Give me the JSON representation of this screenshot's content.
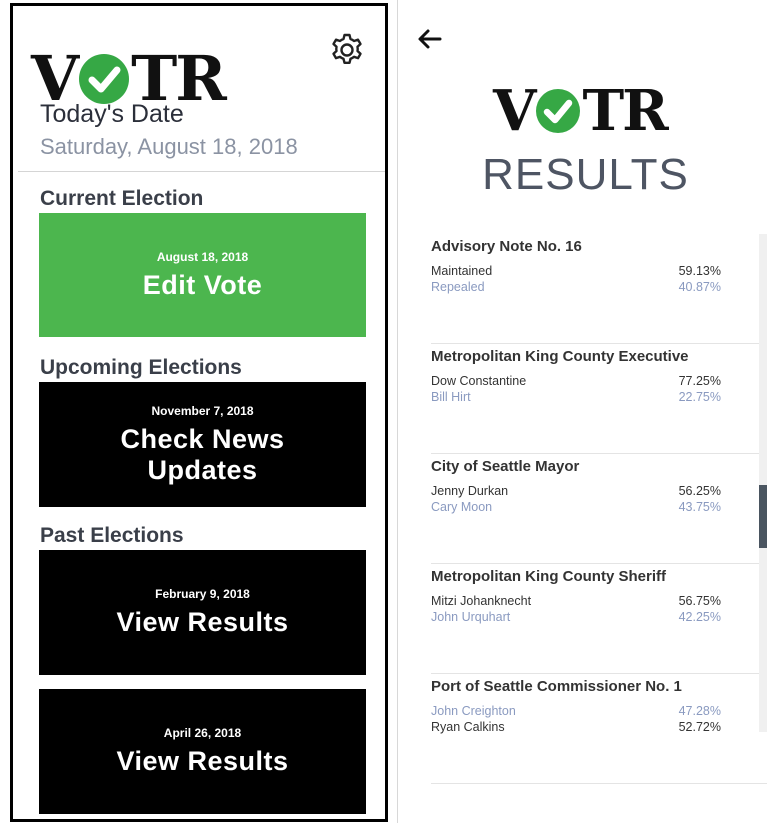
{
  "left": {
    "logo": {
      "v": "V",
      "tr": "TR"
    },
    "todays_date_label": "Today's Date",
    "date_value": "Saturday, August 18, 2018",
    "current_heading": "Current Election",
    "upcoming_heading": "Upcoming Elections",
    "past_heading": "Past Elections",
    "cards": [
      {
        "date": "August 18, 2018",
        "label": "Edit Vote"
      },
      {
        "date": "November 7, 2018",
        "label": "Check News Updates"
      },
      {
        "date": "February 9, 2018",
        "label": "View Results"
      },
      {
        "date": "April 26, 2018",
        "label": "View Results"
      }
    ]
  },
  "right": {
    "logo": {
      "v": "V",
      "tr": "TR"
    },
    "title": "RESULTS",
    "races": [
      {
        "title": "Advisory Note No. 16",
        "candidates": [
          {
            "name": "Maintained",
            "pct": "59.13%",
            "win": true
          },
          {
            "name": "Repealed",
            "pct": "40.87%",
            "win": false
          }
        ]
      },
      {
        "title": "Metropolitan King County Executive",
        "candidates": [
          {
            "name": "Dow Constantine",
            "pct": "77.25%",
            "win": true
          },
          {
            "name": "Bill Hirt",
            "pct": "22.75%",
            "win": false
          }
        ]
      },
      {
        "title": "City of Seattle Mayor",
        "candidates": [
          {
            "name": "Jenny Durkan",
            "pct": "56.25%",
            "win": true
          },
          {
            "name": "Cary Moon",
            "pct": "43.75%",
            "win": false
          }
        ]
      },
      {
        "title": "Metropolitan King County Sheriff",
        "candidates": [
          {
            "name": "Mitzi Johanknecht",
            "pct": "56.75%",
            "win": true
          },
          {
            "name": "John Urquhart",
            "pct": "42.25%",
            "win": false
          }
        ]
      },
      {
        "title": "Port of Seattle Commissioner No. 1",
        "candidates": [
          {
            "name": "John Creighton",
            "pct": "47.28%",
            "win": false
          },
          {
            "name": "Ryan Calkins",
            "pct": "52.72%",
            "win": true
          }
        ]
      }
    ]
  },
  "icons": {
    "settings": "gear-icon",
    "back": "back-arrow-icon",
    "check": "checkmark-icon"
  },
  "colors": {
    "accent_green": "#4cb64e",
    "logo_check": "#36a845",
    "card_black": "#000000",
    "loser_text": "#8a9ac0"
  }
}
